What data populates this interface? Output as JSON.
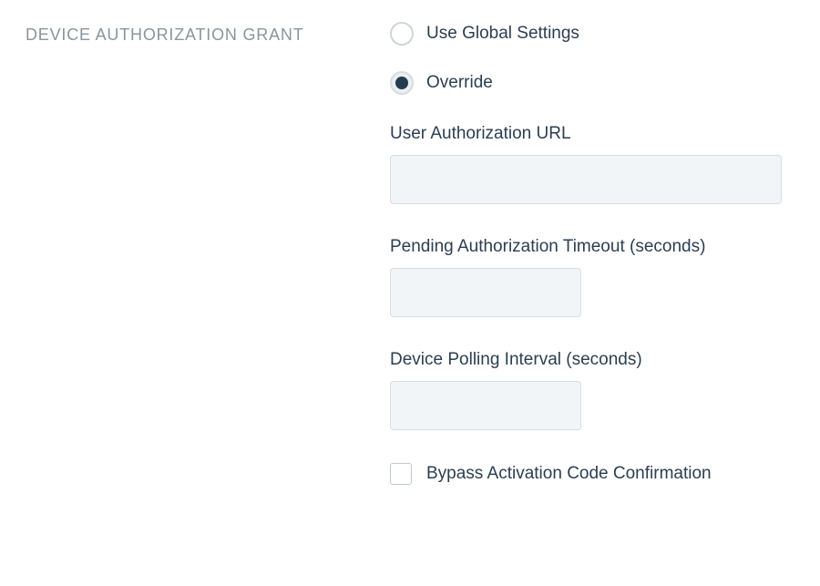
{
  "section": {
    "title": "DEVICE AUTHORIZATION GRANT"
  },
  "radios": {
    "global": {
      "label": "Use Global Settings",
      "selected": false
    },
    "override": {
      "label": "Override",
      "selected": true
    }
  },
  "fields": {
    "user_auth_url": {
      "label": "User Authorization URL",
      "value": ""
    },
    "pending_timeout": {
      "label": "Pending Authorization Timeout (seconds)",
      "value": ""
    },
    "polling_interval": {
      "label": "Device Polling Interval (seconds)",
      "value": ""
    }
  },
  "checkbox": {
    "bypass": {
      "label": "Bypass Activation Code Confirmation",
      "checked": false
    }
  }
}
